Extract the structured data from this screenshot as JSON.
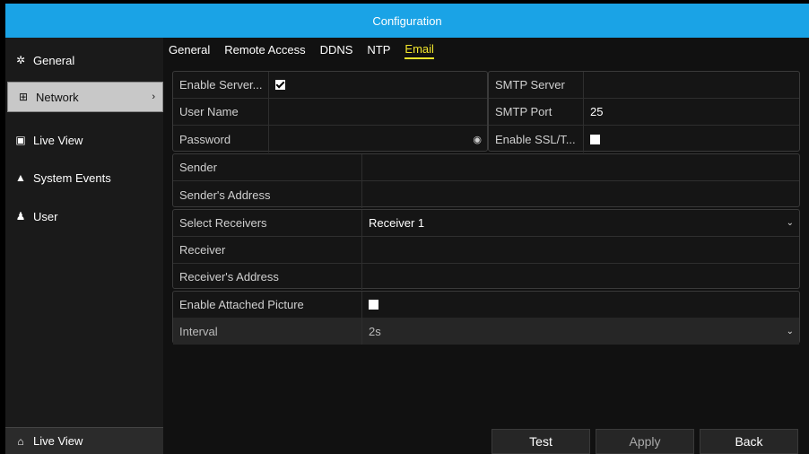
{
  "window": {
    "title": "Configuration"
  },
  "sidebar": {
    "items": [
      {
        "label": "General",
        "icon": "gear-icon"
      },
      {
        "label": "Network",
        "icon": "network-icon",
        "active": true
      },
      {
        "label": "Live View",
        "icon": "camera-icon"
      },
      {
        "label": "System Events",
        "icon": "warning-icon"
      },
      {
        "label": "User",
        "icon": "users-icon"
      }
    ],
    "bottom": {
      "label": "Live View",
      "icon": "home-icon"
    }
  },
  "tabs": [
    {
      "label": "General"
    },
    {
      "label": "Remote Access"
    },
    {
      "label": "DDNS"
    },
    {
      "label": "NTP"
    },
    {
      "label": "Email",
      "active": true
    }
  ],
  "server_panel": {
    "enable_server_label": "Enable Server...",
    "enable_server_checked": true,
    "user_name_label": "User Name",
    "user_name_value": "",
    "password_label": "Password",
    "password_value": "",
    "smtp_server_label": "SMTP Server",
    "smtp_server_value": "",
    "smtp_port_label": "SMTP Port",
    "smtp_port_value": "25",
    "ssl_label": "Enable SSL/T...",
    "ssl_checked": false
  },
  "sender_panel": {
    "sender_label": "Sender",
    "sender_value": "",
    "address_label": "Sender's Address",
    "address_value": ""
  },
  "receiver_panel": {
    "select_label": "Select Receivers",
    "select_value": "Receiver 1",
    "receiver_label": "Receiver",
    "receiver_value": "",
    "address_label": "Receiver's Address",
    "address_value": ""
  },
  "picture_panel": {
    "attach_label": "Enable Attached Picture",
    "attach_checked": false,
    "interval_label": "Interval",
    "interval_value": "2s"
  },
  "buttons": {
    "test": "Test",
    "apply": "Apply",
    "back": "Back"
  }
}
